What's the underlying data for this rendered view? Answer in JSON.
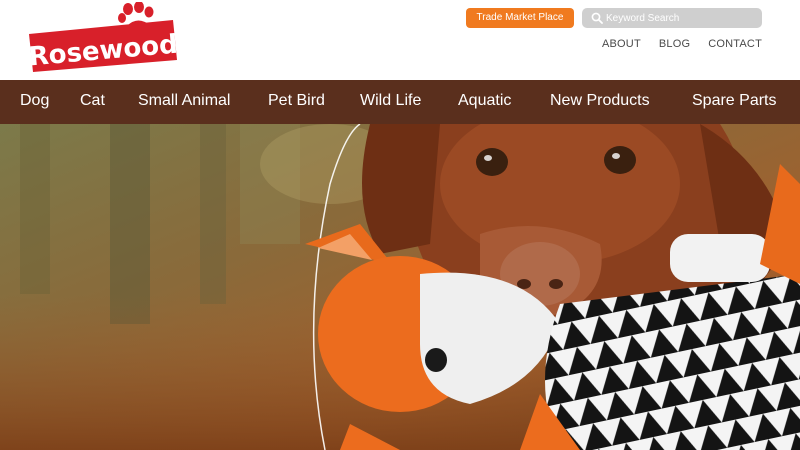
{
  "brand": {
    "name": "Rosewood",
    "red": "#d8202a",
    "orange": "#f07a1f",
    "brown": "#5a2f1d"
  },
  "header": {
    "trade_button": "Trade Market Place",
    "search_placeholder": "Keyword Search",
    "links": [
      "ABOUT",
      "BLOG",
      "CONTACT"
    ]
  },
  "nav": {
    "items": [
      "Dog",
      "Cat",
      "Small Animal",
      "Pet Bird",
      "Wild Life",
      "Aquatic",
      "New Products",
      "Spare Parts"
    ]
  },
  "icons": {
    "search": "search-icon",
    "logo_paw": "paw-icon"
  }
}
